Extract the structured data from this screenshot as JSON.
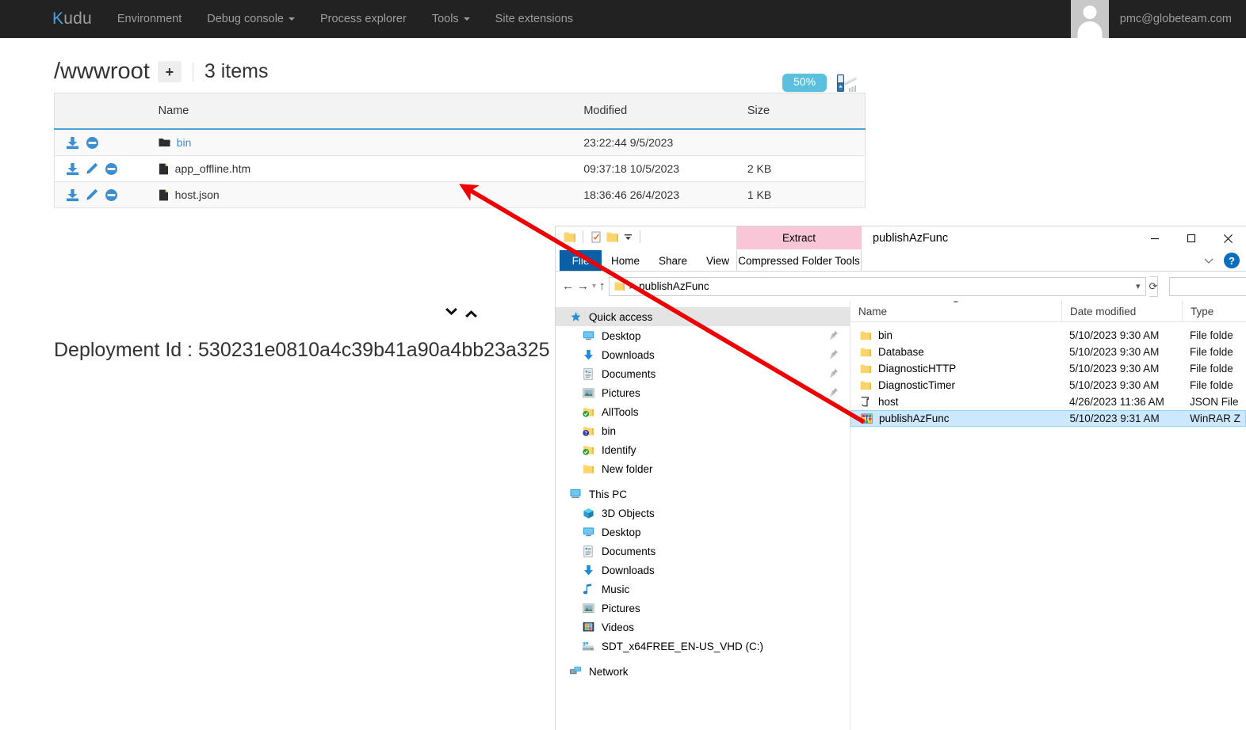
{
  "kudu": {
    "brand": {
      "first_letter": "K",
      "rest": "udu"
    },
    "nav_items": [
      {
        "label": "Environment",
        "has_caret": false
      },
      {
        "label": "Debug console",
        "has_caret": true
      },
      {
        "label": "Process explorer",
        "has_caret": false
      },
      {
        "label": "Tools",
        "has_caret": true
      },
      {
        "label": "Site extensions",
        "has_caret": false
      }
    ],
    "user_email": "pmc@globeteam.com",
    "path": "/wwwroot",
    "add_button_label": "+",
    "item_count": "3 items",
    "upload_progress": "50%",
    "table": {
      "headers": [
        "",
        "Name",
        "Modified",
        "Size"
      ],
      "rows": [
        {
          "actions": [
            "download-icon",
            "delete-icon"
          ],
          "icon": "folder-icon",
          "name": "bin",
          "is_link": true,
          "modified": "23:22:44 9/5/2023",
          "size": ""
        },
        {
          "actions": [
            "download-icon",
            "edit-icon",
            "delete-icon"
          ],
          "icon": "file-icon",
          "name": "app_offline.htm",
          "is_link": false,
          "modified": "09:37:18 10/5/2023",
          "size": "2 KB"
        },
        {
          "actions": [
            "download-icon",
            "edit-icon",
            "delete-icon"
          ],
          "icon": "file-icon",
          "name": "host.json",
          "is_link": false,
          "modified": "18:36:46 26/4/2023",
          "size": "1 KB"
        }
      ]
    },
    "deployment_id": "Deployment Id : 530231e0810a4c39b41a90a4bb23a325",
    "accent_color": "#4aa3df",
    "navbar_color": "#222222"
  },
  "explorer": {
    "title": "publishAzFunc",
    "contextual_group_label": "Compressed Folder Tools",
    "contextual_tab_label": "Extract",
    "tabs": [
      "File",
      "Home",
      "Share",
      "View"
    ],
    "window_controls": [
      "minimize",
      "maximize",
      "close"
    ],
    "help_label": "?",
    "address": {
      "crumbs": [
        "publishAzFunc"
      ],
      "refresh_label": "refresh-icon"
    },
    "search": {
      "value": "",
      "placeholder": ""
    },
    "nav_sections": [
      {
        "header": {
          "label": "Quick access",
          "icon": "pinned-star-icon",
          "selected": true
        },
        "items": [
          {
            "label": "Desktop",
            "icon": "desktop-icon",
            "pinned": true
          },
          {
            "label": "Downloads",
            "icon": "downloads-arrow-icon",
            "pinned": true
          },
          {
            "label": "Documents",
            "icon": "documents-icon",
            "pinned": true
          },
          {
            "label": "Pictures",
            "icon": "pictures-icon",
            "pinned": true
          },
          {
            "label": "AllTools",
            "icon": "folder-sync-green-icon",
            "pinned": false
          },
          {
            "label": "bin",
            "icon": "folder-sync-blue-icon",
            "pinned": false
          },
          {
            "label": "Identify",
            "icon": "folder-sync-green-icon",
            "pinned": false
          },
          {
            "label": "New folder",
            "icon": "folder-icon",
            "pinned": false
          }
        ]
      },
      {
        "header": {
          "label": "This PC",
          "icon": "this-pc-icon",
          "selected": false
        },
        "items": [
          {
            "label": "3D Objects",
            "icon": "3d-objects-icon",
            "pinned": false
          },
          {
            "label": "Desktop",
            "icon": "desktop-icon",
            "pinned": false
          },
          {
            "label": "Documents",
            "icon": "documents-icon",
            "pinned": false
          },
          {
            "label": "Downloads",
            "icon": "downloads-arrow-icon",
            "pinned": false
          },
          {
            "label": "Music",
            "icon": "music-note-icon",
            "pinned": false
          },
          {
            "label": "Pictures",
            "icon": "pictures-icon",
            "pinned": false
          },
          {
            "label": "Videos",
            "icon": "videos-icon",
            "pinned": false
          },
          {
            "label": "SDT_x64FREE_EN-US_VHD (C:)",
            "icon": "hard-drive-icon",
            "pinned": false
          }
        ]
      },
      {
        "header": {
          "label": "Network",
          "icon": "network-icon",
          "selected": false
        },
        "items": []
      }
    ],
    "list": {
      "columns": [
        "Name",
        "Date modified",
        "Type"
      ],
      "sorted_column": "Name",
      "rows": [
        {
          "name": "bin",
          "date_modified": "5/10/2023 9:30 AM",
          "type": "File folde",
          "icon": "folder-icon",
          "selected": false
        },
        {
          "name": "Database",
          "date_modified": "5/10/2023 9:30 AM",
          "type": "File folde",
          "icon": "folder-icon",
          "selected": false
        },
        {
          "name": "DiagnosticHTTP",
          "date_modified": "5/10/2023 9:30 AM",
          "type": "File folde",
          "icon": "folder-icon",
          "selected": false
        },
        {
          "name": "DiagnosticTimer",
          "date_modified": "5/10/2023 9:30 AM",
          "type": "File folde",
          "icon": "folder-icon",
          "selected": false
        },
        {
          "name": "host",
          "date_modified": "4/26/2023 11:36 AM",
          "type": "JSON File",
          "icon": "json-file-icon",
          "selected": false
        },
        {
          "name": "publishAzFunc",
          "date_modified": "5/10/2023 9:31 AM",
          "type": "WinRAR Z",
          "icon": "winrar-archive-icon",
          "selected": true
        }
      ]
    },
    "selection_color": "#cce8ff",
    "file_tab_color": "#0a5fa5",
    "contextual_color": "#f9c6d8"
  },
  "annotation": {
    "arrow_color": "#ee0000",
    "arrow_from": "publishAzFunc file in explorer",
    "arrow_to": "Kudu wwwroot file list"
  }
}
